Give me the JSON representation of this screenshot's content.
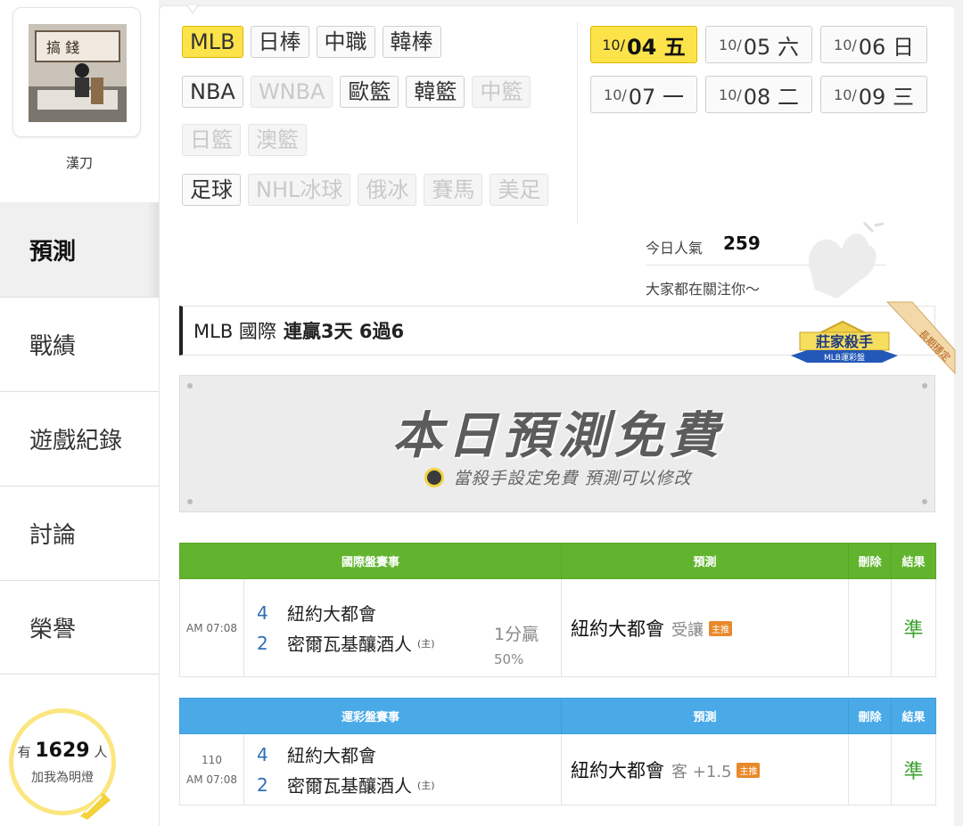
{
  "user": {
    "name": "漢刀"
  },
  "nav": [
    {
      "label": "預測",
      "active": true
    },
    {
      "label": "戰績"
    },
    {
      "label": "遊戲紀錄"
    },
    {
      "label": "討論"
    },
    {
      "label": "榮譽"
    }
  ],
  "fans": {
    "prefix": "有",
    "count": "1629",
    "suffix": "人",
    "action": "加我為明燈"
  },
  "sports_rows": [
    [
      {
        "label": "MLB",
        "state": "on"
      },
      {
        "label": "日棒"
      },
      {
        "label": "中職"
      },
      {
        "label": "韓棒"
      }
    ],
    [
      {
        "label": "NBA"
      },
      {
        "label": "WNBA",
        "state": "dim"
      },
      {
        "label": "歐籃"
      },
      {
        "label": "韓籃"
      },
      {
        "label": "中籃",
        "state": "dim"
      }
    ],
    [
      {
        "label": "日籃",
        "state": "dim"
      },
      {
        "label": "澳籃",
        "state": "dim"
      }
    ],
    [
      {
        "label": "足球"
      },
      {
        "label": "NHL冰球",
        "state": "dim"
      },
      {
        "label": "俄冰",
        "state": "dim"
      },
      {
        "label": "賽馬",
        "state": "dim"
      },
      {
        "label": "美足",
        "state": "dim"
      }
    ]
  ],
  "dates": [
    {
      "m": "10/",
      "d": "04 五",
      "state": "on"
    },
    {
      "m": "10/",
      "d": "05 六"
    },
    {
      "m": "10/",
      "d": "06 日"
    },
    {
      "m": "10/",
      "d": "07 一"
    },
    {
      "m": "10/",
      "d": "08 二"
    },
    {
      "m": "10/",
      "d": "09 三"
    }
  ],
  "popularity": {
    "label": "今日人氣",
    "value": "259",
    "subtitle": "大家都在關注你～"
  },
  "record": {
    "league": "MLB 國際",
    "summary": "連贏3天 6過6"
  },
  "badge": {
    "title": "莊家殺手",
    "sub": "MLB運彩盤",
    "ribbon": "長期穩定"
  },
  "banner": {
    "title": "本日預測免費",
    "subtitle": "當殺手設定免費 預測可以修改"
  },
  "intl_table": {
    "headers": {
      "event": "國際盤賽事",
      "prediction": "預測",
      "delete": "刪除",
      "result": "結果"
    },
    "row": {
      "time": "AM 07:08",
      "away_no": "4",
      "away": "紐約大都會",
      "home_no": "2",
      "home": "密爾瓦基釀酒人",
      "home_tag": "(主)",
      "handicap": "1分贏",
      "handicap_pct": "50%",
      "pick": "紐約大都會",
      "pick_note": "受讓",
      "pick_tag": "主推",
      "result": "準"
    }
  },
  "lottery_table": {
    "headers": {
      "event": "運彩盤賽事",
      "prediction": "預測",
      "delete": "刪除",
      "result": "結果"
    },
    "row": {
      "game_no": "110",
      "time": "AM 07:08",
      "away_no": "4",
      "away": "紐約大都會",
      "home_no": "2",
      "home": "密爾瓦基釀酒人",
      "home_tag": "(主)",
      "pick": "紐約大都會",
      "pick_note": "客 +1.5",
      "pick_tag": "主推",
      "result": "準"
    }
  },
  "colors": {
    "accent_yellow": "#fce34a",
    "green_header": "#62b42f",
    "blue_header": "#4aaae8",
    "result_green": "#3aa12e"
  },
  "icons": [
    "avatar-photo",
    "light-bulb-icon",
    "pin-icon"
  ]
}
